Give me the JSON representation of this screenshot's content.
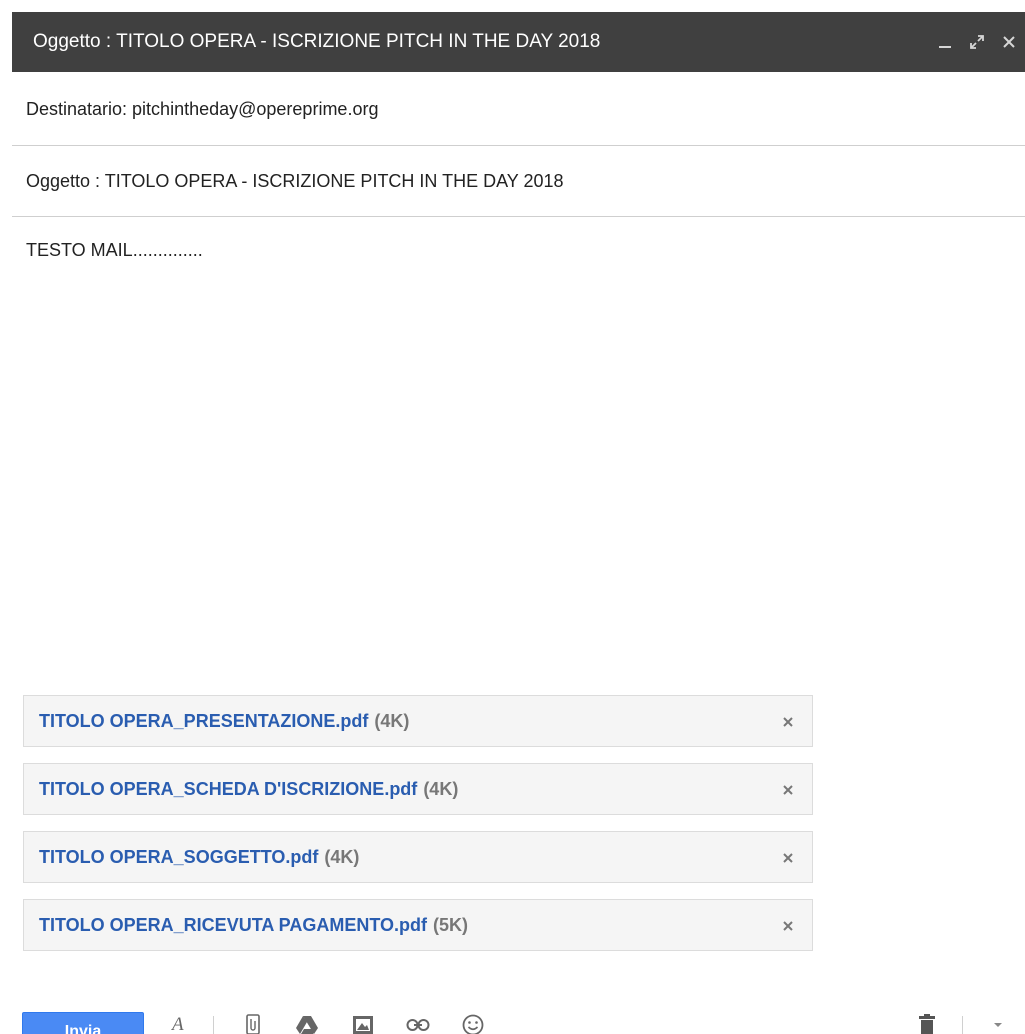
{
  "window": {
    "title": "Oggetto : TITOLO OPERA - ISCRIZIONE PITCH IN THE DAY 2018"
  },
  "compose": {
    "to_field": "Destinatario: pitchintheday@opereprime.org",
    "subject_field": "Oggetto : TITOLO OPERA - ISCRIZIONE PITCH IN THE DAY 2018",
    "body_text": "TESTO MAIL.............."
  },
  "attachments": [
    {
      "name": "TITOLO OPERA_PRESENTAZIONE.pdf",
      "size": "(4K)"
    },
    {
      "name": "TITOLO OPERA_SCHEDA D'ISCRIZIONE.pdf",
      "size": "(4K)"
    },
    {
      "name": "TITOLO OPERA_SOGGETTO.pdf",
      "size": "(4K)"
    },
    {
      "name": "TITOLO OPERA_RICEVUTA PAGAMENTO.pdf",
      "size": "(5K)"
    }
  ],
  "toolbar": {
    "send_label": "Invia"
  },
  "icons": {
    "minimize": "minimize-icon",
    "expand": "expand-icon",
    "close": "close-icon",
    "formatting": "text-formatting-icon",
    "attach": "paperclip-icon",
    "drive": "drive-icon",
    "photo": "photo-icon",
    "link": "link-icon",
    "emoji": "emoji-icon",
    "trash": "trash-icon",
    "more": "chevron-down-icon"
  },
  "colors": {
    "titlebar": "#404040",
    "send_button": "#4a8af4",
    "attachment_link": "#2a5db0"
  }
}
